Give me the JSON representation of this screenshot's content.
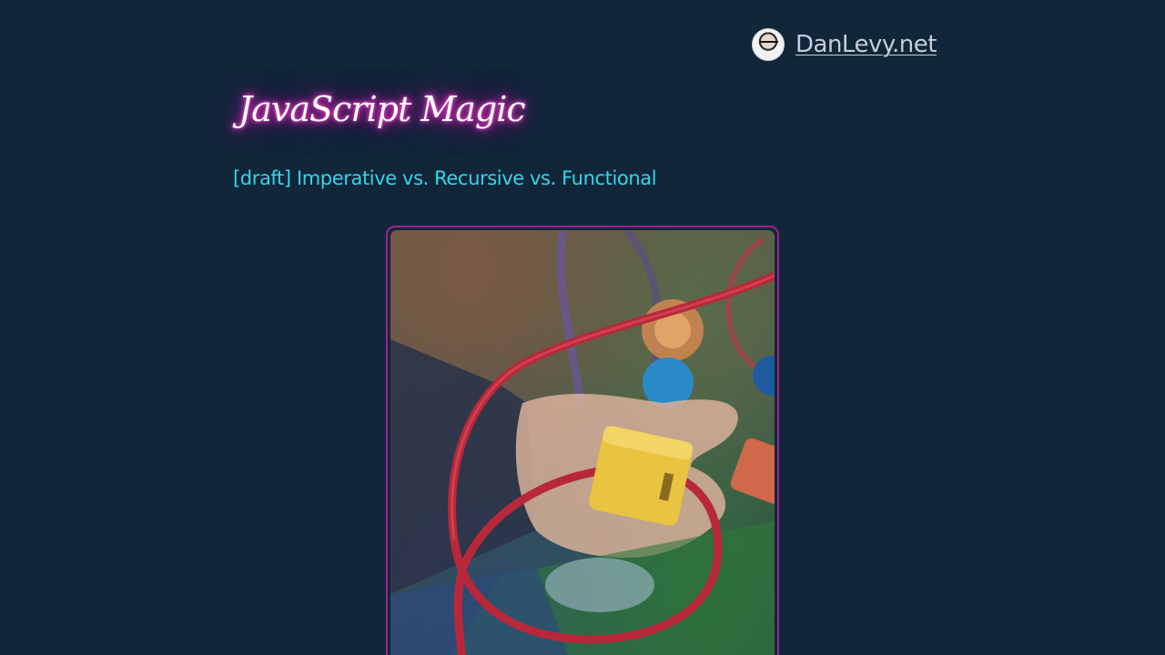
{
  "header": {
    "site_name": "DanLevy.net"
  },
  "blog": {
    "title": "JavaScript Magic"
  },
  "post": {
    "title": "[draft] Imperative vs. Recursive vs. Functional"
  },
  "hero": {
    "alt": "Child playing with a bead maze toy"
  },
  "colors": {
    "background": "#12263a",
    "accent_pink": "#e22bc0",
    "accent_cyan": "#36d6e6",
    "frame_border": "#a02090"
  }
}
